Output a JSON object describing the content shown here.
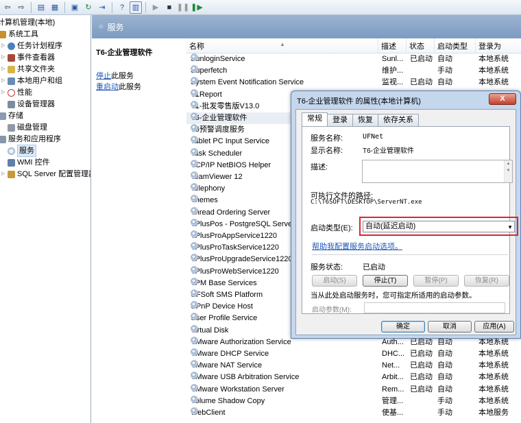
{
  "toolbar": {
    "buttons": [
      "back-arrow-icon",
      "console-tree-icon",
      "properties-icon",
      "refresh-icon",
      "export-icon",
      "help-icon",
      "view-icon",
      "play-icon",
      "stop-icon",
      "pause-icon",
      "restart-icon"
    ]
  },
  "tree": {
    "items": [
      {
        "label": "计算机管理(本地)",
        "level": 0
      },
      {
        "label": "系统工具",
        "level": 1
      },
      {
        "label": "任务计划程序",
        "level": 2
      },
      {
        "label": "事件查看器",
        "level": 2
      },
      {
        "label": "共享文件夹",
        "level": 2
      },
      {
        "label": "本地用户和组",
        "level": 2
      },
      {
        "label": "性能",
        "level": 2
      },
      {
        "label": "设备管理器",
        "level": 2
      },
      {
        "label": "存储",
        "level": 1
      },
      {
        "label": "磁盘管理",
        "level": 2
      },
      {
        "label": "服务和应用程序",
        "level": 1
      },
      {
        "label": "服务",
        "level": 2,
        "selected": true
      },
      {
        "label": "WMI 控件",
        "level": 2
      },
      {
        "label": "SQL Server 配置管理器",
        "level": 2
      }
    ]
  },
  "header": {
    "title": "服务"
  },
  "extended": {
    "service_name": "T6-企业管理软件",
    "stop_link": "停止",
    "stop_rest": "此服务",
    "restart_link": "重启动",
    "restart_rest": "此服务"
  },
  "columns": {
    "name": "名称",
    "desc": "描述",
    "status": "状态",
    "start": "启动类型",
    "logon": "登录为"
  },
  "rows": [
    {
      "name": "SunloginService",
      "desc": "Sunl...",
      "status": "已启动",
      "start": "自动",
      "logon": "本地系统"
    },
    {
      "name": "Superfetch",
      "desc": "维护...",
      "status": "",
      "start": "手动",
      "logon": "本地系统"
    },
    {
      "name": "System Event Notification Service",
      "desc": "监视...",
      "status": "已启动",
      "start": "自动",
      "logon": "本地系统"
    },
    {
      "name": "T1Report",
      "desc": "",
      "status": "",
      "start": "",
      "logon": ""
    },
    {
      "name": "T1-批发零售版V13.0",
      "desc": "",
      "status": "",
      "start": "",
      "logon": ""
    },
    {
      "name": "T6-企业管理软件",
      "desc": "",
      "status": "",
      "start": "",
      "logon": "",
      "highlight": true
    },
    {
      "name": "T6预警调度服务",
      "desc": "",
      "status": "",
      "start": "",
      "logon": ""
    },
    {
      "name": "Tablet PC Input Service",
      "desc": "",
      "status": "",
      "start": "",
      "logon": ""
    },
    {
      "name": "Task Scheduler",
      "desc": "",
      "status": "",
      "start": "",
      "logon": ""
    },
    {
      "name": "TCP/IP NetBIOS Helper",
      "desc": "",
      "status": "",
      "start": "",
      "logon": ""
    },
    {
      "name": "TeamViewer 12",
      "desc": "",
      "status": "",
      "start": "",
      "logon": ""
    },
    {
      "name": "Telephony",
      "desc": "",
      "status": "",
      "start": "",
      "logon": ""
    },
    {
      "name": "Themes",
      "desc": "",
      "status": "",
      "start": "",
      "logon": ""
    },
    {
      "name": "Thread Ordering Server",
      "desc": "",
      "status": "",
      "start": "",
      "logon": ""
    },
    {
      "name": "TPlusPos - PostgreSQL Server",
      "desc": "",
      "status": "",
      "start": "",
      "logon": ""
    },
    {
      "name": "TPlusProAppService1220",
      "desc": "",
      "status": "",
      "start": "",
      "logon": ""
    },
    {
      "name": "TPlusProTaskService1220",
      "desc": "",
      "status": "",
      "start": "",
      "logon": ""
    },
    {
      "name": "TPlusProUpgradeService1220",
      "desc": "",
      "status": "",
      "start": "",
      "logon": ""
    },
    {
      "name": "TPlusProWebService1220",
      "desc": "",
      "status": "",
      "start": "",
      "logon": ""
    },
    {
      "name": "TPM Base Services",
      "desc": "",
      "status": "",
      "start": "",
      "logon": ""
    },
    {
      "name": "UFSoft SMS Platform",
      "desc": "",
      "status": "",
      "start": "",
      "logon": ""
    },
    {
      "name": "UPnP Device Host",
      "desc": "",
      "status": "",
      "start": "",
      "logon": ""
    },
    {
      "name": "User Profile Service",
      "desc": "",
      "status": "",
      "start": "",
      "logon": ""
    },
    {
      "name": "Virtual Disk",
      "desc": "",
      "status": "",
      "start": "",
      "logon": ""
    },
    {
      "name": "VMware Authorization Service",
      "desc": "Auth...",
      "status": "已启动",
      "start": "自动",
      "logon": "本地系统"
    },
    {
      "name": "VMware DHCP Service",
      "desc": "DHC...",
      "status": "已启动",
      "start": "自动",
      "logon": "本地系统"
    },
    {
      "name": "VMware NAT Service",
      "desc": "Net...",
      "status": "已启动",
      "start": "自动",
      "logon": "本地系统"
    },
    {
      "name": "VMware USB Arbitration Service",
      "desc": "Arbit...",
      "status": "已启动",
      "start": "自动",
      "logon": "本地系统"
    },
    {
      "name": "VMware Workstation Server",
      "desc": "Rem...",
      "status": "已启动",
      "start": "自动",
      "logon": "本地系统"
    },
    {
      "name": "Volume Shadow Copy",
      "desc": "管理...",
      "status": "",
      "start": "手动",
      "logon": "本地系统"
    },
    {
      "name": "WebClient",
      "desc": "使基...",
      "status": "",
      "start": "手动",
      "logon": "本地服务"
    }
  ],
  "dialog": {
    "title": "T6-企业管理软件 的属性(本地计算机)",
    "close": "X",
    "tabs": [
      "常规",
      "登录",
      "恢复",
      "依存关系"
    ],
    "service_name_label": "服务名称:",
    "service_name_value": "UFNet",
    "display_name_label": "显示名称:",
    "display_name_value": "T6-企业管理软件",
    "description_label": "描述:",
    "path_label": "可执行文件的路径:",
    "path_value": "C:\\T6SOFT\\DESKTOP\\ServerNT.exe",
    "startup_type_label": "启动类型(E):",
    "startup_type_value": "自动(延迟启动)",
    "help_link": "帮助我配置服务启动选项。",
    "status_label": "服务状态:",
    "status_value": "已启动",
    "start_btn": "启动(S)",
    "stop_btn": "停止(T)",
    "pause_btn": "暂停(P)",
    "resume_btn": "恢复(R)",
    "hint": "当从此处启动服务时，您可指定所适用的启动参数。",
    "params_label": "启动参数(M):",
    "ok_btn": "确定",
    "cancel_btn": "取消",
    "apply_btn": "应用(A)"
  }
}
